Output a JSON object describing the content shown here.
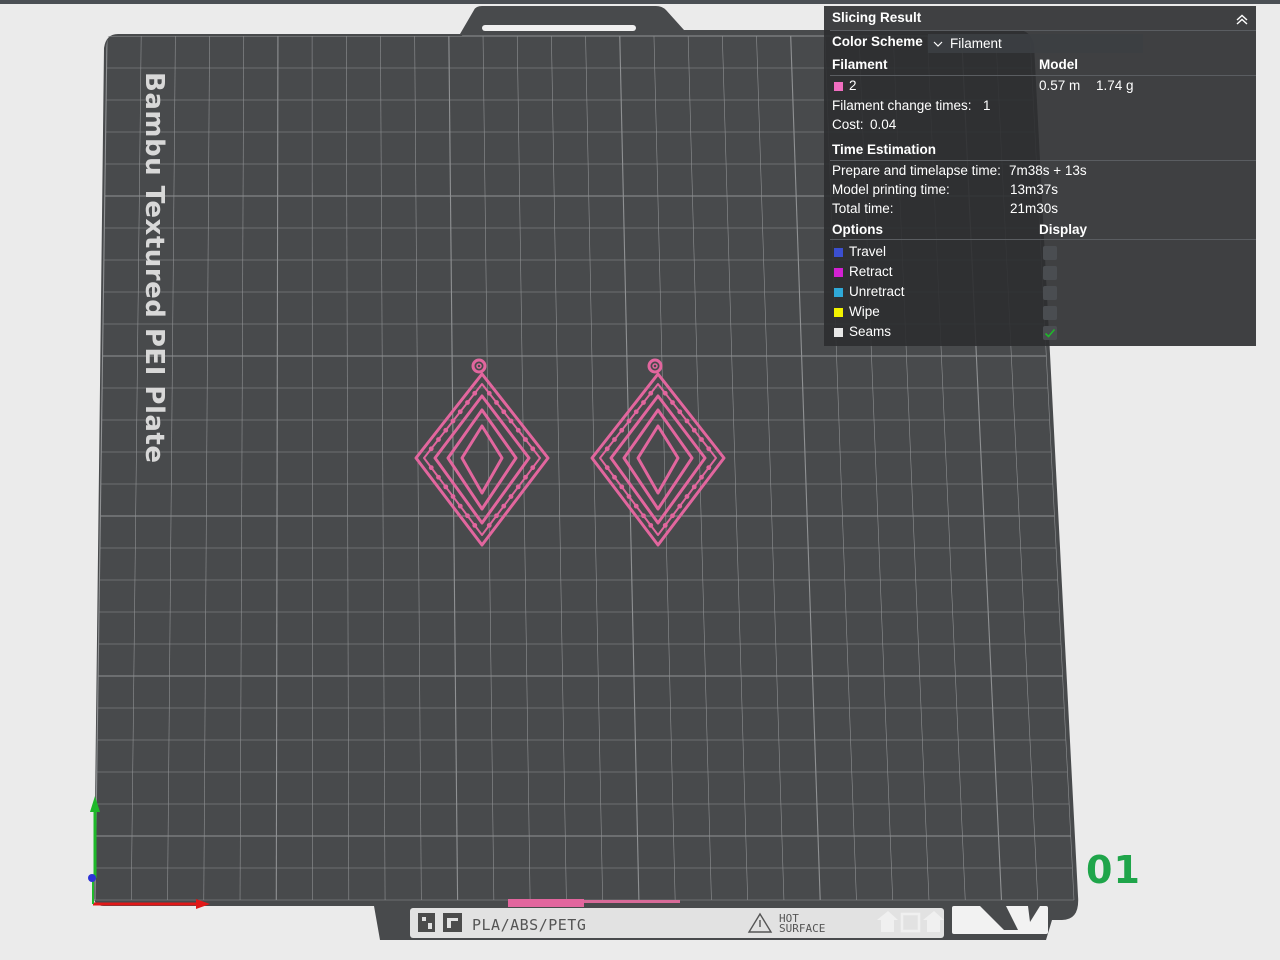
{
  "panel": {
    "title": "Slicing Result",
    "color_scheme_label": "Color Scheme",
    "color_scheme_value": "Filament",
    "filament_header": "Filament",
    "model_header": "Model",
    "filament_index": "2",
    "filament_color": "#f06ec0",
    "filament_length": "0.57 m",
    "filament_weight": "1.74 g",
    "change_times_label": "Filament change times:",
    "change_times_value": "1",
    "cost_label": "Cost:",
    "cost_value": "0.04",
    "time_header": "Time Estimation",
    "prepare_label": "Prepare and timelapse time:",
    "prepare_value": "7m38s + 13s",
    "model_time_label": "Model printing time:",
    "model_time_value": "13m37s",
    "total_label": "Total time:",
    "total_value": "21m30s",
    "options_header": "Options",
    "display_header": "Display",
    "options": [
      {
        "label": "Travel",
        "color": "#3b4fd0",
        "checked": false
      },
      {
        "label": "Retract",
        "color": "#d321d3",
        "checked": false
      },
      {
        "label": "Unretract",
        "color": "#2fa9d8",
        "checked": false
      },
      {
        "label": "Wipe",
        "color": "#f2f200",
        "checked": false
      },
      {
        "label": "Seams",
        "color": "#e8e8e8",
        "checked": true
      }
    ]
  },
  "plate": {
    "name": "Bambu Textured PEI Plate",
    "material_label": "PLA/ABS/PETG",
    "hot_surface_line1": "HOT",
    "hot_surface_line2": "SURFACE",
    "plate_number": "01"
  },
  "colors": {
    "plate_fill": "#484a4c",
    "grid_line": "#8f9193",
    "model_color": "#e2669e",
    "axis_x": "#e01818",
    "axis_y": "#1fb82a",
    "axis_z": "#2d32d6",
    "plate_number": "#1fa54a"
  }
}
